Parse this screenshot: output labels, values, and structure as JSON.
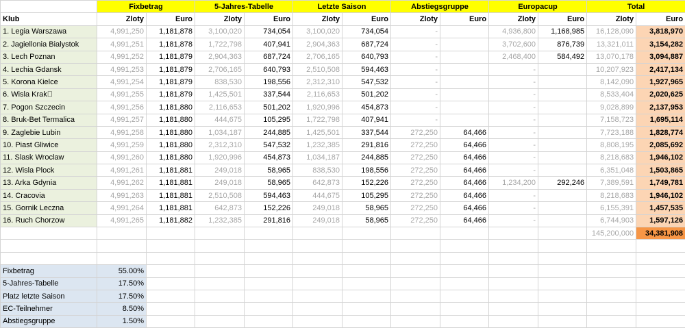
{
  "headers": {
    "groups": [
      "Fixbetrag",
      "5-Jahres-Tabelle",
      "Letzte Saison",
      "Abstiegsgruppe",
      "Europacup",
      "Total"
    ],
    "klub": "Klub",
    "zloty": "Zloty",
    "euro": "Euro"
  },
  "rows": [
    {
      "club": "1. Legia Warszawa",
      "fz": "4,991,250",
      "fe": "1,181,878",
      "jz": "3,100,020",
      "je": "734,054",
      "lz": "3,100,020",
      "le": "734,054",
      "az": "-",
      "ae": "",
      "ez": "4,936,800",
      "ee": "1,168,985",
      "tz": "16,128,090",
      "te": "3,818,970"
    },
    {
      "club": "2. Jagiellonia Bialystok",
      "fz": "4,991,251",
      "fe": "1,181,878",
      "jz": "1,722,798",
      "je": "407,941",
      "lz": "2,904,363",
      "le": "687,724",
      "az": "-",
      "ae": "",
      "ez": "3,702,600",
      "ee": "876,739",
      "tz": "13,321,011",
      "te": "3,154,282"
    },
    {
      "club": "3. Lech Poznan",
      "fz": "4,991,252",
      "fe": "1,181,879",
      "jz": "2,904,363",
      "je": "687,724",
      "lz": "2,706,165",
      "le": "640,793",
      "az": "-",
      "ae": "",
      "ez": "2,468,400",
      "ee": "584,492",
      "tz": "13,070,178",
      "te": "3,094,887"
    },
    {
      "club": "4. Lechia Gdansk",
      "fz": "4,991,253",
      "fe": "1,181,879",
      "jz": "2,706,165",
      "je": "640,793",
      "lz": "2,510,508",
      "le": "594,463",
      "az": "-",
      "ae": "",
      "ez": "-",
      "ee": "",
      "tz": "10,207,923",
      "te": "2,417,134"
    },
    {
      "club": "5. Korona Kielce",
      "fz": "4,991,254",
      "fe": "1,181,879",
      "jz": "838,530",
      "je": "198,556",
      "lz": "2,312,310",
      "le": "547,532",
      "az": "-",
      "ae": "",
      "ez": "-",
      "ee": "",
      "tz": "8,142,090",
      "te": "1,927,965"
    },
    {
      "club": "6. Wisla Krak\u0000",
      "fz": "4,991,255",
      "fe": "1,181,879",
      "jz": "1,425,501",
      "je": "337,544",
      "lz": "2,116,653",
      "le": "501,202",
      "az": "-",
      "ae": "",
      "ez": "-",
      "ee": "",
      "tz": "8,533,404",
      "te": "2,020,625"
    },
    {
      "club": "7. Pogon Szczecin",
      "fz": "4,991,256",
      "fe": "1,181,880",
      "jz": "2,116,653",
      "je": "501,202",
      "lz": "1,920,996",
      "le": "454,873",
      "az": "-",
      "ae": "",
      "ez": "-",
      "ee": "",
      "tz": "9,028,899",
      "te": "2,137,953"
    },
    {
      "club": "8. Bruk-Bet Termalica",
      "fz": "4,991,257",
      "fe": "1,181,880",
      "jz": "444,675",
      "je": "105,295",
      "lz": "1,722,798",
      "le": "407,941",
      "az": "-",
      "ae": "",
      "ez": "-",
      "ee": "",
      "tz": "7,158,723",
      "te": "1,695,114"
    },
    {
      "club": "9. Zaglebie Lubin",
      "fz": "4,991,258",
      "fe": "1,181,880",
      "jz": "1,034,187",
      "je": "244,885",
      "lz": "1,425,501",
      "le": "337,544",
      "az": "272,250",
      "ae": "64,466",
      "ez": "-",
      "ee": "",
      "tz": "7,723,188",
      "te": "1,828,774"
    },
    {
      "club": "10. Piast Gliwice",
      "fz": "4,991,259",
      "fe": "1,181,880",
      "jz": "2,312,310",
      "je": "547,532",
      "lz": "1,232,385",
      "le": "291,816",
      "az": "272,250",
      "ae": "64,466",
      "ez": "-",
      "ee": "",
      "tz": "8,808,195",
      "te": "2,085,692"
    },
    {
      "club": "11. Slask Wroclaw",
      "fz": "4,991,260",
      "fe": "1,181,880",
      "jz": "1,920,996",
      "je": "454,873",
      "lz": "1,034,187",
      "le": "244,885",
      "az": "272,250",
      "ae": "64,466",
      "ez": "-",
      "ee": "",
      "tz": "8,218,683",
      "te": "1,946,102"
    },
    {
      "club": "12. Wisla Plock",
      "fz": "4,991,261",
      "fe": "1,181,881",
      "jz": "249,018",
      "je": "58,965",
      "lz": "838,530",
      "le": "198,556",
      "az": "272,250",
      "ae": "64,466",
      "ez": "-",
      "ee": "",
      "tz": "6,351,048",
      "te": "1,503,865"
    },
    {
      "club": "13. Arka Gdynia",
      "fz": "4,991,262",
      "fe": "1,181,881",
      "jz": "249,018",
      "je": "58,965",
      "lz": "642,873",
      "le": "152,226",
      "az": "272,250",
      "ae": "64,466",
      "ez": "1,234,200",
      "ee": "292,246",
      "tz": "7,389,591",
      "te": "1,749,781"
    },
    {
      "club": "14. Cracovia",
      "fz": "4,991,263",
      "fe": "1,181,881",
      "jz": "2,510,508",
      "je": "594,463",
      "lz": "444,675",
      "le": "105,295",
      "az": "272,250",
      "ae": "64,466",
      "ez": "-",
      "ee": "",
      "tz": "8,218,683",
      "te": "1,946,102"
    },
    {
      "club": "15. Gornik Leczna",
      "fz": "4,991,264",
      "fe": "1,181,881",
      "jz": "642,873",
      "je": "152,226",
      "lz": "249,018",
      "le": "58,965",
      "az": "272,250",
      "ae": "64,466",
      "ez": "-",
      "ee": "",
      "tz": "6,155,391",
      "te": "1,457,535"
    },
    {
      "club": "16. Ruch Chorzow",
      "fz": "4,991,265",
      "fe": "1,181,882",
      "jz": "1,232,385",
      "je": "291,816",
      "lz": "249,018",
      "le": "58,965",
      "az": "272,250",
      "ae": "64,466",
      "ez": "-",
      "ee": "",
      "tz": "6,744,903",
      "te": "1,597,126"
    }
  ],
  "grand_total": {
    "zloty": "145,200,000",
    "euro": "34,381,908"
  },
  "weights": [
    {
      "label": "Fixbetrag",
      "value": "55.00%"
    },
    {
      "label": "5-Jahres-Tabelle",
      "value": "17.50%"
    },
    {
      "label": "Platz letzte Saison",
      "value": "17.50%"
    },
    {
      "label": "EC-Teilnehmer",
      "value": "8.50%"
    },
    {
      "label": "Abstiegsgruppe",
      "value": "1.50%"
    }
  ],
  "colors": {
    "header_yellow": "#ffff00",
    "club_green": "#ebf1de",
    "total_peach": "#fcd5b4",
    "grand_orange": "#f79646",
    "weights_blue": "#dce6f1"
  }
}
